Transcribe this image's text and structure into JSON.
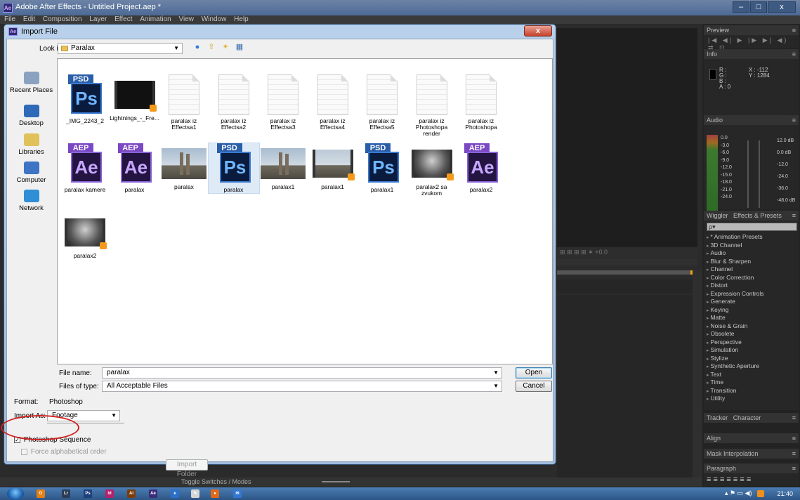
{
  "app": {
    "title": "Adobe After Effects - Untitled Project.aep *",
    "icon_label": "Ae",
    "window_controls": [
      "–",
      "□",
      "x"
    ],
    "menu": [
      "File",
      "Edit",
      "Composition",
      "Layer",
      "Effect",
      "Animation",
      "View",
      "Window",
      "Help"
    ]
  },
  "dialog": {
    "title": "Import File",
    "close_label": "x",
    "look_in_label": "Look in:",
    "look_in_value": "Paralax",
    "places": [
      {
        "label": "Recent Places",
        "icon": "recent-places-icon"
      },
      {
        "label": "Desktop",
        "icon": "desktop-icon"
      },
      {
        "label": "Libraries",
        "icon": "libraries-icon"
      },
      {
        "label": "Computer",
        "icon": "computer-icon"
      },
      {
        "label": "Network",
        "icon": "network-icon"
      }
    ],
    "files": [
      {
        "name": "_IMG_2243_2",
        "type": "psd"
      },
      {
        "name": "Lightnings_-_Fre...",
        "type": "video"
      },
      {
        "name": "paralax iz Effectsa1",
        "type": "doc"
      },
      {
        "name": "paralax iz Effectsa2",
        "type": "doc"
      },
      {
        "name": "paralax iz Effectsa3",
        "type": "doc"
      },
      {
        "name": "paralax iz Effectsa4",
        "type": "doc"
      },
      {
        "name": "paralax iz Effectsa5",
        "type": "doc"
      },
      {
        "name": "paralax iz Photoshopa render",
        "type": "doc"
      },
      {
        "name": "paralax iz Photoshopa",
        "type": "doc"
      },
      {
        "name": "paralax kamere",
        "type": "aep"
      },
      {
        "name": "paralax",
        "type": "aep"
      },
      {
        "name": "paralax",
        "type": "photo"
      },
      {
        "name": "paralax",
        "type": "psd",
        "selected": true
      },
      {
        "name": "paralax1",
        "type": "photo"
      },
      {
        "name": "paralax1",
        "type": "photo-video"
      },
      {
        "name": "paralax1",
        "type": "psd"
      },
      {
        "name": "paralax2 sa zvukom",
        "type": "dark-video"
      },
      {
        "name": "paralax2",
        "type": "aep"
      },
      {
        "name": "paralax2",
        "type": "dark-video"
      }
    ],
    "file_name_label": "File name:",
    "file_name_value": "paralax",
    "files_of_type_label": "Files of type:",
    "files_of_type_value": "All Acceptable Files",
    "open_label": "Open",
    "cancel_label": "Cancel",
    "format_label": "Format:",
    "format_value": "Photoshop",
    "import_as_label": "Import As:",
    "import_as_value": "Footage",
    "photoshop_sequence_label": "Photoshop Sequence",
    "photoshop_sequence_checked": true,
    "force_alpha_label": "Force alphabetical order",
    "import_folder_label": "Import Folder",
    "highlight_color": "#d22222"
  },
  "panels": {
    "preview_tab": "Preview",
    "preview_controls": "|◀ ◀| ▶ |▶ ▶| ◀) ⇄ ⊡",
    "info_tab": "Info",
    "info_rgba": "R :\nG :\nB :\nA : 0",
    "info_xy": "X : -112\nY : 1284",
    "audio_tab": "Audio",
    "audio_left_scale": [
      "0.0",
      "-3.0",
      "-6.0",
      "-9.0",
      "-12.0",
      "-15.0",
      "-18.0",
      "-21.0",
      "-24.0"
    ],
    "audio_right_scale": [
      "12.0 dB",
      "0.0 dB",
      "-12.0",
      "-24.0",
      "-36.0",
      "-48.0 dB"
    ],
    "wiggler_tab": "Wiggler",
    "effects_tab": "Effects & Presets",
    "effects_search": "ρ▾",
    "effects": [
      "* Animation Presets",
      "3D Channel",
      "Audio",
      "Blur & Sharpen",
      "Channel",
      "Color Correction",
      "Distort",
      "Expression Controls",
      "Generate",
      "Keying",
      "Matte",
      "Noise & Grain",
      "Obsolete",
      "Perspective",
      "Simulation",
      "Stylize",
      "Synthetic Aperture",
      "Text",
      "Time",
      "Transition",
      "Utility"
    ],
    "tracker_tab": "Tracker",
    "character_tab": "Character",
    "align_tab": "Align",
    "mask_tab": "Mask Interpolation",
    "paragraph_tab": "Paragraph",
    "paragraph_align_icons": "≡ ≡ ≡ ≡ ≡ ≡ ≡"
  },
  "timeline": {
    "toggle_label": "Toggle Switches / Modes",
    "comp_toolbar_text": "⊞ ⊞ ⊞ ⊞ ✶ +0.0",
    "accent_color": "#f0a21a"
  },
  "taskbar": {
    "apps": [
      {
        "icon": "outlook-icon",
        "color": "#e57f12",
        "label": "O"
      },
      {
        "icon": "lightroom-icon",
        "color": "#2b3d55",
        "label": "Lr"
      },
      {
        "icon": "photoshop-icon",
        "color": "#1d3f7a",
        "label": "Ps"
      },
      {
        "icon": "indesign-icon",
        "color": "#b3206b",
        "label": "Id"
      },
      {
        "icon": "illustrator-icon",
        "color": "#7a3d0a",
        "label": "Ai"
      },
      {
        "icon": "aftereffects-icon",
        "color": "#3a2d79",
        "label": "Ae"
      },
      {
        "icon": "ie-icon",
        "color": "#2a6fc9",
        "label": "e"
      },
      {
        "icon": "paint-icon",
        "color": "#d6d6d6",
        "label": "✎"
      },
      {
        "icon": "firefox-icon",
        "color": "#e06a1a",
        "label": "●"
      },
      {
        "icon": "msn-icon",
        "color": "#3476d4",
        "label": "✉"
      }
    ],
    "clock": "21:40",
    "tray": "▴ ⚑ ▭ ◀)"
  }
}
